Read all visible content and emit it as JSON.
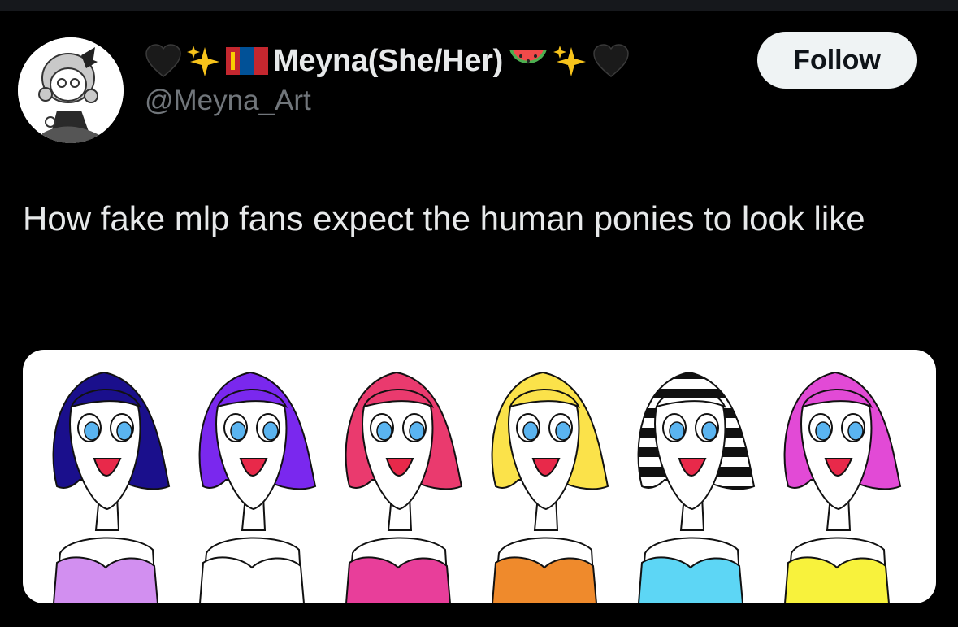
{
  "author": {
    "name_emoji_left": [
      "black-heart",
      "sparkles",
      "mongolia-flag"
    ],
    "display_name": "Meyna(She/Her)",
    "name_emoji_right": [
      "watermelon",
      "sparkles",
      "black-heart"
    ],
    "handle": "@Meyna_Art",
    "avatar_icon": "avatar-icon"
  },
  "follow_button": {
    "label": "Follow"
  },
  "tweet": {
    "text": "How fake mlp fans expect the human ponies to look like"
  },
  "media": {
    "figures": [
      {
        "hair": "#1a0f8c",
        "top": "#d28ff0"
      },
      {
        "hair": "#7a28ee",
        "top": "#ffffff"
      },
      {
        "hair": "#ea3a6e",
        "top": "#e83e9a"
      },
      {
        "hair": "#fbe24a",
        "top": "#ef8a2c"
      },
      {
        "hair": "stripes",
        "top": "#5dd6f5"
      },
      {
        "hair": "#e24ad6",
        "top": "#f8f23c"
      }
    ]
  },
  "colors": {
    "background": "#000000",
    "text": "#e7e9ea",
    "secondary_text": "#71767b",
    "button_bg": "#eff3f4",
    "button_text": "#0f1419"
  }
}
